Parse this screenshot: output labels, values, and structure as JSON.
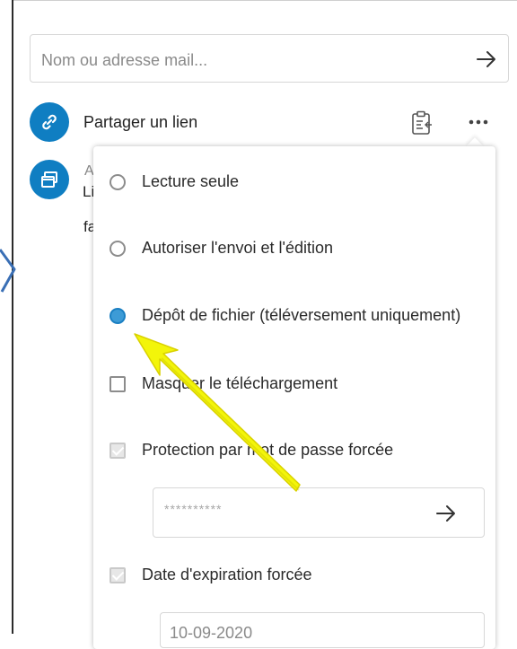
{
  "share": {
    "search_placeholder": "Nom ou adresse mail...",
    "link_label": "Partager un lien",
    "second_item_line1_partial": "A",
    "second_item_line2_partial": "Li",
    "second_item_line3_partial": "fa"
  },
  "menu": {
    "options": [
      {
        "type": "radio",
        "label": "Lecture seule",
        "checked": false
      },
      {
        "type": "radio",
        "label": "Autoriser l'envoi et l'édition",
        "checked": false
      },
      {
        "type": "radio",
        "label": "Dépôt de fichier (téléversement uniquement)",
        "checked": true
      },
      {
        "type": "checkbox",
        "label": "Masquer le téléchargement",
        "checked": false
      },
      {
        "type": "checkbox",
        "label": "Protection par mot de passe forcée",
        "checked": true,
        "disabled": true
      },
      {
        "type": "checkbox",
        "label": "Date d'expiration forcée",
        "checked": true,
        "disabled": true
      }
    ],
    "password_value": "**********",
    "date_value": "10-09-2020"
  },
  "icons": {
    "link_avatar": "link-icon",
    "group_avatar": "windows-icon",
    "clipboard": "clipboard-icon",
    "more": "more-dots-icon",
    "submit": "arrow-right-icon"
  },
  "colors": {
    "accent": "#0f7ec2",
    "annotation": "#f3f50a"
  }
}
